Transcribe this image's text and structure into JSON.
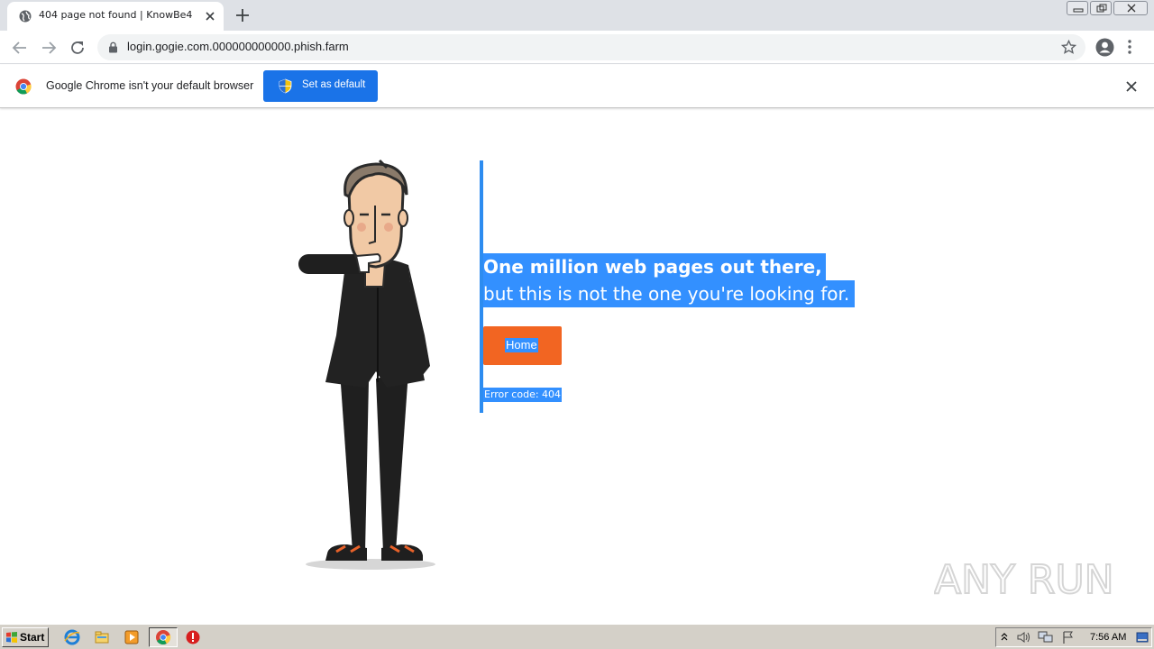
{
  "browser": {
    "tab": {
      "title": "404 page not found | KnowBe4"
    },
    "url": "login.gogie.com.000000000000.phish.farm"
  },
  "infobar": {
    "message": "Google Chrome isn't your default browser",
    "button_label": "Set as default"
  },
  "page": {
    "headline_line1": "One million web pages out there,",
    "headline_line2": "but this is not the one you're looking for.",
    "home_button": "Home",
    "error_code": "Error code: 404"
  },
  "watermark": {
    "text": "ANY RUN"
  },
  "taskbar": {
    "start_label": "Start",
    "clock": "7:56 AM"
  },
  "colors": {
    "accent_blue": "#1a73e8",
    "selection_blue": "#3390ff",
    "rule_blue": "#2d8cf0",
    "home_orange": "#f26522"
  }
}
